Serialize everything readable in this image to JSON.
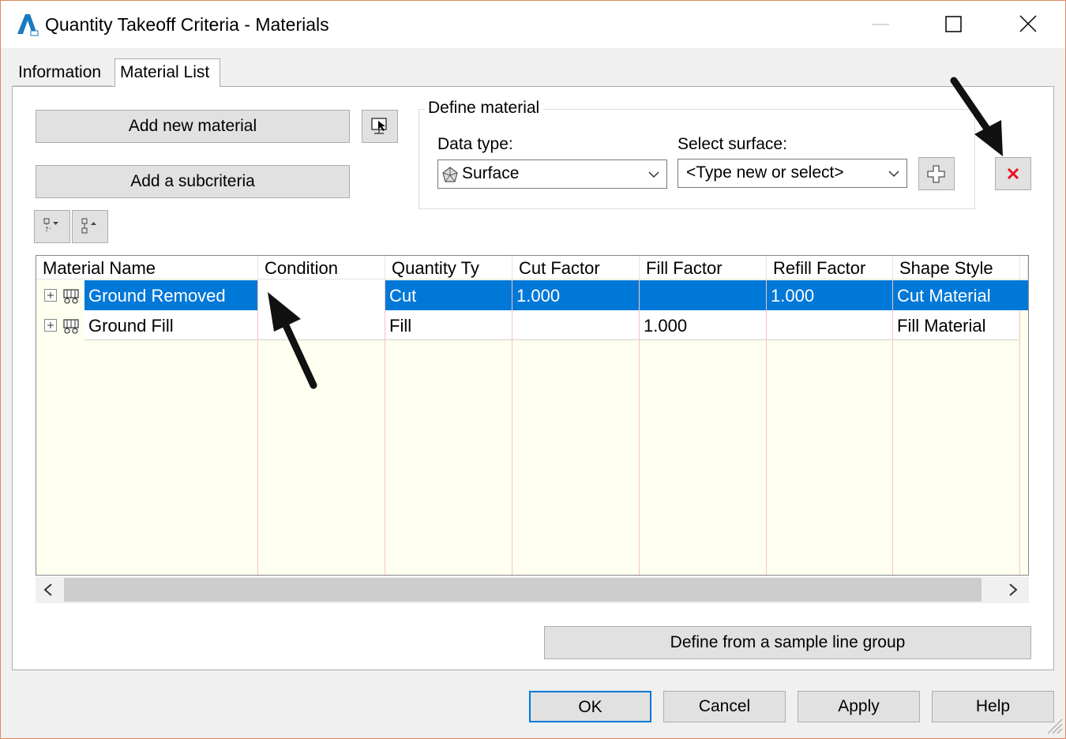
{
  "window": {
    "title": "Quantity Takeoff Criteria - Materials"
  },
  "tabs": [
    {
      "label": "Information"
    },
    {
      "label": "Material List"
    }
  ],
  "buttons": {
    "add_material": "Add new material",
    "add_subcriteria": "Add a subcriteria",
    "define_sample": "Define from a sample line group",
    "ok": "OK",
    "cancel": "Cancel",
    "apply": "Apply",
    "help": "Help"
  },
  "define_material": {
    "group_title": "Define material",
    "data_type_label": "Data type:",
    "data_type_value": "Surface",
    "select_surface_label": "Select surface:",
    "select_surface_value": "<Type new or select>"
  },
  "grid": {
    "columns": [
      "Material Name",
      "Condition",
      "Quantity Ty",
      "Cut Factor",
      "Fill Factor",
      "Refill Factor",
      "Shape Style"
    ],
    "rows": [
      {
        "name": "Ground Removed",
        "condition": "",
        "quantity_type": "Cut",
        "cut_factor": "1.000",
        "fill_factor": "",
        "refill_factor": "1.000",
        "shape_style": "Cut Material",
        "selected": true
      },
      {
        "name": "Ground Fill",
        "condition": "",
        "quantity_type": "Fill",
        "cut_factor": "",
        "fill_factor": "1.000",
        "refill_factor": "",
        "shape_style": "Fill Material",
        "selected": false
      }
    ]
  },
  "colors": {
    "selection": "#0078d7",
    "grid_background": "#fffff0",
    "delete_icon": "#e81123"
  },
  "icons": [
    "autocad-icon",
    "minimize-icon",
    "maximize-icon",
    "close-icon",
    "pick-from-drawing-icon",
    "expand-all-icon",
    "collapse-all-icon",
    "surface-icon",
    "chevron-down-icon",
    "add-icon",
    "delete-icon",
    "plus-box-icon",
    "material-icon",
    "scroll-left-icon",
    "scroll-right-icon",
    "pointer-arrow-icon"
  ]
}
